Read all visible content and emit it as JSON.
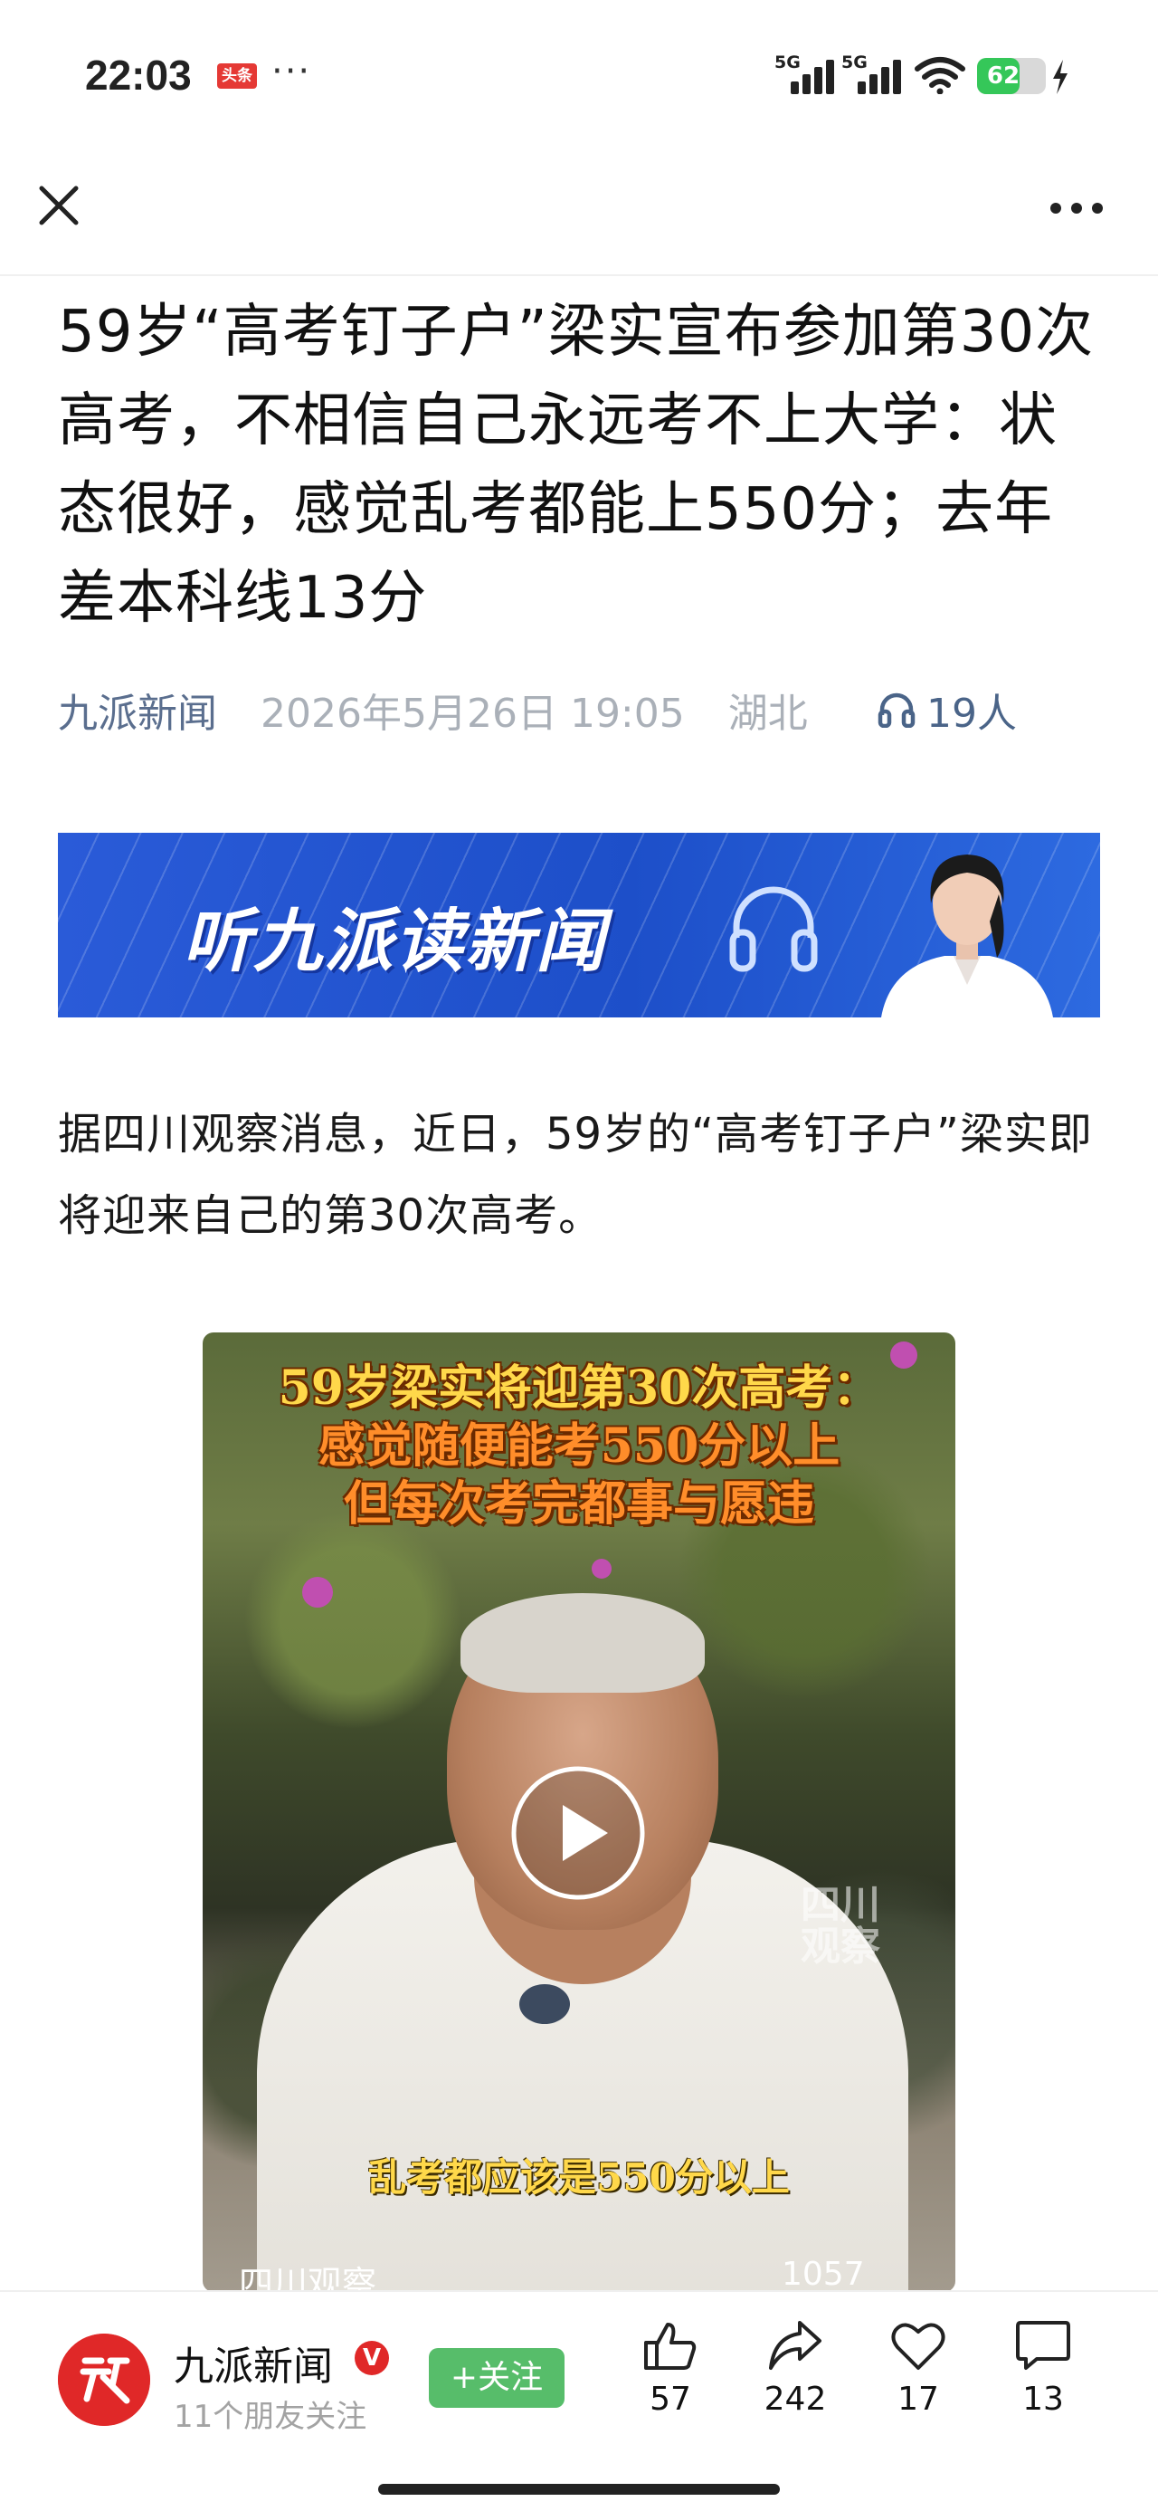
{
  "status_bar": {
    "time": "22:03",
    "app_badge": "头条",
    "more_dots": "···",
    "signal1_label": "5G",
    "signal2_label": "5G",
    "battery_level": "62",
    "battery_fraction": 0.62
  },
  "toolbar": {
    "close_icon": "close-icon",
    "more_icon": "more-dots-icon"
  },
  "article": {
    "headline": "59岁“高考钉子户”梁实宣布参加第30次高考，不相信自己永远考不上大学：状态很好，感觉乱考都能上550分；去年差本科线13分",
    "source": "九派新闻",
    "datetime": "2026年5月26日 19:05",
    "location": "湖北",
    "listeners": "19人",
    "banner_text": "听九派读新闻",
    "paragraph": "据四川观察消息，近日，59岁的“高考钉子户”梁实即将迎来自己的第30次高考。"
  },
  "video": {
    "caption_line1": "59岁梁实将迎第30次高考：",
    "caption_line2": "感觉随便能考550分以上",
    "caption_line3": "但每次考完都事与愿违",
    "subtitle": "乱考都应该是550分以上",
    "watermark": "四川观察",
    "footer_source": "四川观察",
    "footer_likes": "1057"
  },
  "bottom_bar": {
    "account_name": "九派新闻",
    "account_sub": "11个朋友关注",
    "follow_label": "+关注",
    "likes": "57",
    "shares": "242",
    "favorites": "17",
    "comments": "13"
  },
  "colors": {
    "accent_blue": "#1d4fc9",
    "follow_green": "#57bd6a",
    "brand_red": "#e02828",
    "battery_green": "#35c759"
  }
}
